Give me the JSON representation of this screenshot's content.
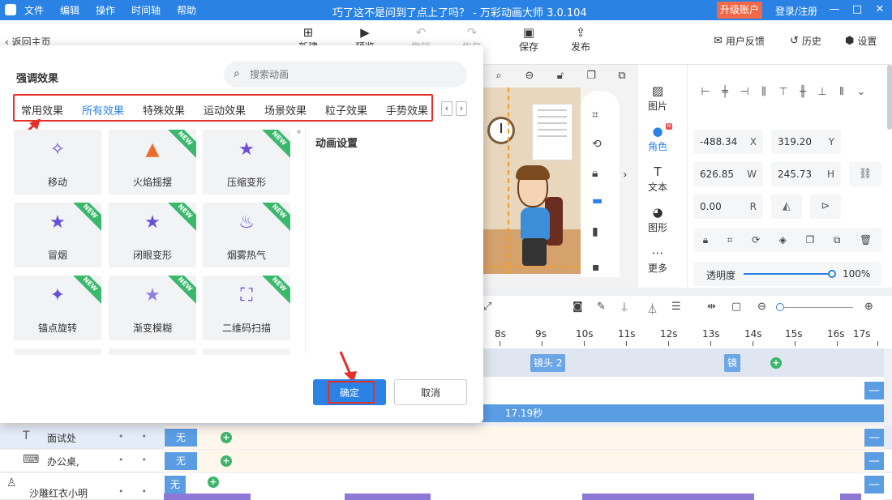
{
  "titlebar": {
    "menu": [
      "文件",
      "编辑",
      "操作",
      "时间轴",
      "帮助"
    ],
    "title": "巧了这不是问到了点上了吗？ - 万彩动画大师 3.0.104",
    "upgrade": "升级账户",
    "login": "登录/注册"
  },
  "toolbar": {
    "back": "返回主页",
    "new": "新建",
    "preview": "预览",
    "undo": "撤销",
    "redo": "恢复",
    "save": "保存",
    "publish": "发布",
    "feedback": "用户反馈",
    "history": "历史",
    "settings": "设置"
  },
  "right_panel": {
    "tabs": [
      "图片",
      "角色",
      "文本",
      "图形",
      "更多"
    ],
    "active_tab": "角色",
    "x": "-488.34",
    "x_unit": "X",
    "y": "319.20",
    "y_unit": "Y",
    "w": "626.85",
    "w_unit": "W",
    "h": "245.73",
    "h_unit": "H",
    "r": "0.00",
    "r_unit": "R",
    "opacity_label": "透明度",
    "opacity_value": "100%",
    "opacity_level": 1.0
  },
  "timeline": {
    "ticks": [
      "8s",
      "9s",
      "10s",
      "11s",
      "12s",
      "13s",
      "14s",
      "15s",
      "16s",
      "17s"
    ],
    "lens_label": "镜头 2",
    "lens_label_short": "镜",
    "duration": "17.19秒",
    "tracks": [
      {
        "name": "面试处",
        "chip": "无"
      },
      {
        "name": "办公桌,",
        "chip": "无"
      },
      {
        "name": "沙雕红衣小明",
        "chip": "无"
      }
    ]
  },
  "modal": {
    "title": "强调效果",
    "search_placeholder": "搜索动画",
    "tabs": [
      "常用效果",
      "所有效果",
      "特殊效果",
      "运动效果",
      "场景效果",
      "粒子效果",
      "手势效果"
    ],
    "active_tab": "所有效果",
    "effects": [
      {
        "label": "移动",
        "icon": "stars-path-icon",
        "is_new": false
      },
      {
        "label": "火焰摇摆",
        "icon": "flame-icon",
        "is_new": true
      },
      {
        "label": "压缩变形",
        "icon": "star-compress-icon",
        "is_new": true
      },
      {
        "label": "冒烟",
        "icon": "smoke-star-icon",
        "is_new": true
      },
      {
        "label": "闭眼变形",
        "icon": "star-morph-icon",
        "is_new": true
      },
      {
        "label": "烟雾热气",
        "icon": "steam-icon",
        "is_new": true
      },
      {
        "label": "锚点旋转",
        "icon": "anchor-rotate-icon",
        "is_new": true
      },
      {
        "label": "渐变模糊",
        "icon": "blur-star-icon",
        "is_new": true
      },
      {
        "label": "二维码扫描",
        "icon": "scan-star-icon",
        "is_new": true
      }
    ],
    "new_badge": "NEW",
    "settings_title": "动画设置",
    "confirm": "确定",
    "cancel": "取消"
  }
}
